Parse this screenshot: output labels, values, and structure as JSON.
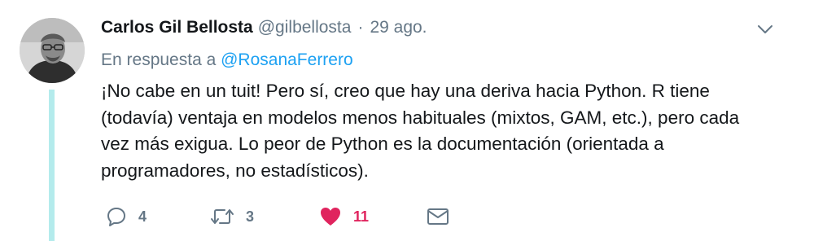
{
  "tweet": {
    "author_name": "Carlos Gil Bellosta",
    "handle": "@gilbellosta",
    "separator": "·",
    "time": "29 ago.",
    "reply_prefix": "En respuesta a",
    "reply_mention": "@RosanaFerrero",
    "text": "¡No cabe en un tuit! Pero sí, creo que hay una deriva hacia Python. R tiene (todavía) ventaja en modelos menos habituales (mixtos, GAM, etc.), pero cada vez más exigua. Lo peor de Python es la documentación (orientada a programadores, no estadísticos).",
    "actions": {
      "reply_count": "4",
      "retweet_count": "3",
      "like_count": "11",
      "dm_count": ""
    }
  },
  "colors": {
    "thread_line": "#b4ebec",
    "mention": "#1da1f2",
    "like": "#e0245e",
    "muted": "#657786"
  },
  "icons": [
    "chevron-down-icon",
    "reply-icon",
    "retweet-icon",
    "heart-icon",
    "envelope-icon"
  ]
}
